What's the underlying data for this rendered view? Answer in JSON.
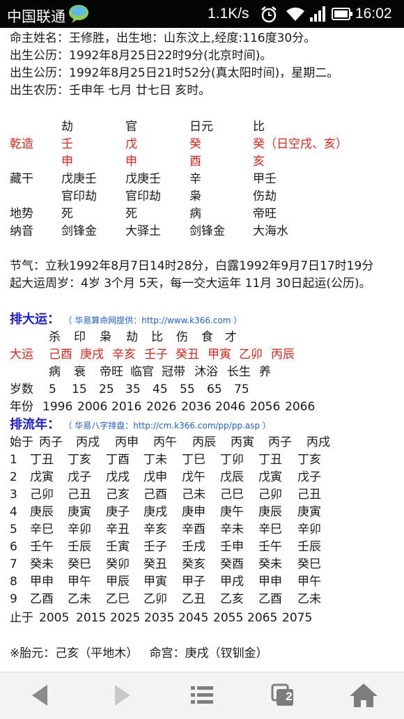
{
  "status": {
    "carrier": "中国联通",
    "speed": "1.1K/s",
    "time": "16:02"
  },
  "info_lines": [
    "命主姓名：王修胜，出生地：山东汶上,经度:116度30分。",
    "出生公历：1992年8月25日22时9分(北京时间)。",
    "出生公历：1992年8月25日21时52分(真太阳时间)，星期二。",
    "出生农历：壬申年 七月 廿七日 亥时。"
  ],
  "chart": {
    "gods": [
      "劫",
      "官",
      "日元",
      "比"
    ],
    "qianzao_label": "乾造",
    "stems": [
      "壬",
      "戊",
      "癸",
      "癸（日空戌、亥）"
    ],
    "branches": [
      "申",
      "申",
      "酉",
      "亥"
    ],
    "canggan_label": "藏干",
    "canggan": [
      "戊庚壬",
      "戊庚壬",
      "辛",
      "甲壬"
    ],
    "canggan_gods": [
      "官印劫",
      "官印劫",
      "枭",
      "伤劫"
    ],
    "dishi_label": "地势",
    "dishi": [
      "死",
      "死",
      "病",
      "帝旺"
    ],
    "nayin_label": "纳音",
    "nayin": [
      "剑锋金",
      "大驿土",
      "剑锋金",
      "大海水"
    ]
  },
  "jieqi_line": "节气：立秋1992年8月7日14时28分，白露1992年9月7日17时19分",
  "qiyun_line": "起大运周岁：4岁 3个月 5天，每一交大运年 11月 30日起运(公历)。",
  "dayun": {
    "title": "排大运：",
    "note": "（ 华易算命网提供：http://www.k366.com ）",
    "gods": [
      "杀",
      "印",
      "枭",
      "劫",
      "比",
      "伤",
      "食",
      "才"
    ],
    "label": "大运",
    "pillars": [
      "己酉",
      "庚戌",
      "辛亥",
      "壬子",
      "癸丑",
      "甲寅",
      "乙卯",
      "丙辰"
    ],
    "stages": [
      "病",
      "衰",
      "帝旺",
      "临官",
      "冠带",
      "沐浴",
      "长生",
      "养"
    ],
    "ages_label": "岁数",
    "ages": [
      "5",
      "15",
      "25",
      "35",
      "45",
      "55",
      "65",
      "75"
    ],
    "years_label": "年份",
    "years": [
      "1996",
      "2006",
      "2016",
      "2026",
      "2036",
      "2046",
      "2056",
      "2066"
    ]
  },
  "liunian": {
    "title": "排流年：",
    "note": "（ 华易八字排盘：http://cm.k366.com/pp/pp.asp ）",
    "start_label": "始于",
    "start": [
      "丙子",
      "丙戌",
      "丙申",
      "丙午",
      "丙辰",
      "丙寅",
      "丙子",
      "丙戌"
    ],
    "rows": [
      {
        "n": "1",
        "cells": [
          "丁丑",
          "丁亥",
          "丁酉",
          "丁未",
          "丁巳",
          "丁卯",
          "丁丑",
          "丁亥"
        ]
      },
      {
        "n": "2",
        "cells": [
          "戊寅",
          "戊子",
          "戊戌",
          "戊申",
          "戊午",
          "戊辰",
          "戊寅",
          "戊子"
        ]
      },
      {
        "n": "3",
        "cells": [
          "己卯",
          "己丑",
          "己亥",
          "己酉",
          "己未",
          "己巳",
          "己卯",
          "己丑"
        ]
      },
      {
        "n": "4",
        "cells": [
          "庚辰",
          "庚寅",
          "庚子",
          "庚戌",
          "庚申",
          "庚午",
          "庚辰",
          "庚寅"
        ]
      },
      {
        "n": "5",
        "cells": [
          "辛巳",
          "辛卯",
          "辛丑",
          "辛亥",
          "辛酉",
          "辛未",
          "辛巳",
          "辛卯"
        ]
      },
      {
        "n": "6",
        "cells": [
          "壬午",
          "壬辰",
          "壬寅",
          "壬子",
          "壬戌",
          "壬申",
          "壬午",
          "壬辰"
        ]
      },
      {
        "n": "7",
        "cells": [
          "癸未",
          "癸巳",
          "癸卯",
          "癸丑",
          "癸亥",
          "癸酉",
          "癸未",
          "癸巳"
        ]
      },
      {
        "n": "8",
        "cells": [
          "甲申",
          "甲午",
          "甲辰",
          "甲寅",
          "甲子",
          "甲戌",
          "甲申",
          "甲午"
        ]
      },
      {
        "n": "9",
        "cells": [
          "乙酉",
          "乙未",
          "乙巳",
          "乙卯",
          "乙丑",
          "乙亥",
          "乙酉",
          "乙未"
        ]
      }
    ],
    "end_label": "止于",
    "end": [
      "2005",
      "2015",
      "2025",
      "2035",
      "2045",
      "2055",
      "2065",
      "2075"
    ]
  },
  "taiyuan_line": "※胎元：己亥（平地木）   命宫：庚戌（钗钏金）",
  "nav": {
    "tabs_badge": "2"
  }
}
